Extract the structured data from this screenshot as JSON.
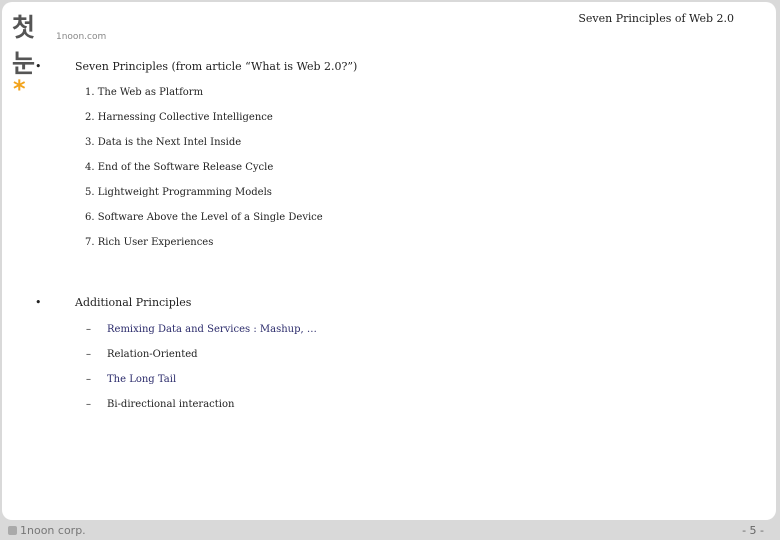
{
  "logo": {
    "korean": "첫눈",
    "asterisk": "*",
    "sub": "1noon.com"
  },
  "header": {
    "title": "Seven Principles of Web 2.0"
  },
  "bullets": [
    {
      "marker": "•",
      "text": "Seven Principles (from article “What is Web 2.0?”)"
    },
    {
      "marker": "•",
      "text": "Additional Principles"
    }
  ],
  "principles": [
    "1. The Web as Platform",
    "2. Harnessing Collective Intelligence",
    "3. Data is the Next Intel Inside",
    "4. End of the Software Release Cycle",
    "5. Lightweight Programming Models",
    "6. Software Above the Level of a Single Device",
    "7. Rich User Experiences"
  ],
  "additional": [
    {
      "marker": "–",
      "text": "Remixing Data and Services : Mashup, …",
      "color": "#2b2b6b"
    },
    {
      "marker": "–",
      "text": "Relation-Oriented",
      "color": "#222222"
    },
    {
      "marker": "–",
      "text": "The Long Tail",
      "color": "#2b2b6b"
    },
    {
      "marker": "–",
      "text": "Bi-directional interaction",
      "color": "#222222"
    }
  ],
  "footer": {
    "company": "1noon corp.",
    "page": "- 5 -"
  }
}
